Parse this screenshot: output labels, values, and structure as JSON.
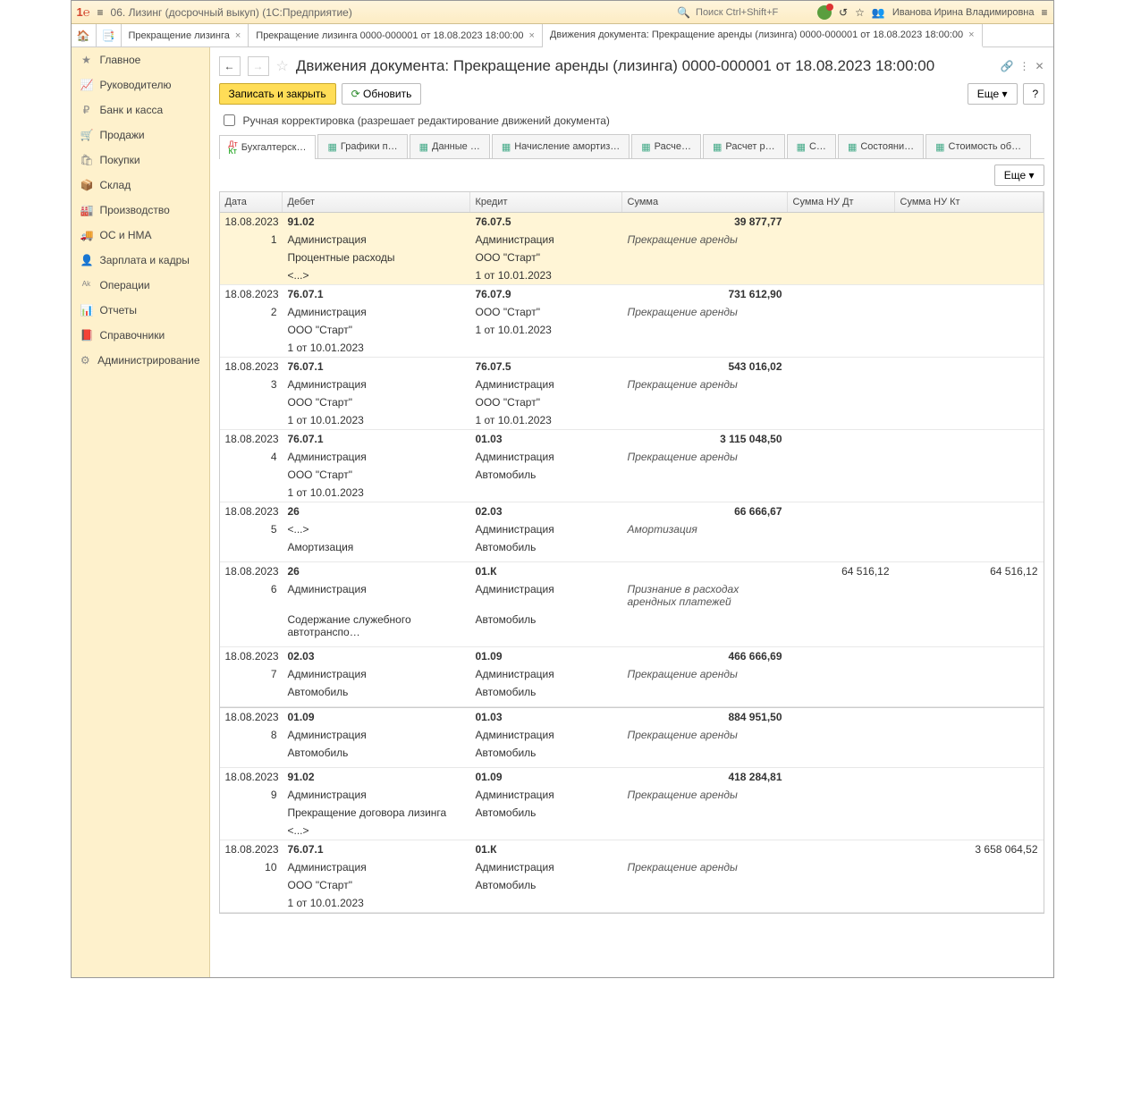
{
  "app": {
    "title": "06. Лизинг (досрочный выкуп)  (1С:Предприятие)",
    "search_placeholder": "Поиск Ctrl+Shift+F",
    "user": "Иванова Ирина Владимировна"
  },
  "doctabs": [
    {
      "label": "Прекращение лизинга"
    },
    {
      "label": "Прекращение лизинга 0000-000001 от 18.08.2023 18:00:00"
    },
    {
      "label": "Движения документа: Прекращение аренды (лизинга) 0000-000001 от 18.08.2023 18:00:00",
      "active": true
    }
  ],
  "sidebar": [
    "Главное",
    "Руководителю",
    "Банк и касса",
    "Продажи",
    "Покупки",
    "Склад",
    "Производство",
    "ОС и НМА",
    "Зарплата и кадры",
    "Операции",
    "Отчеты",
    "Справочники",
    "Администрирование"
  ],
  "sidebar_icons": [
    "★",
    "📈",
    "₽",
    "🛒",
    "🛍",
    "📦",
    "🏭",
    "🚚",
    "👤",
    "ᴬᵏ",
    "📊",
    "📕",
    "⚙"
  ],
  "page": {
    "title": "Движения документа: Прекращение аренды (лизинга) 0000-000001 от 18.08.2023 18:00:00",
    "save_close": "Записать и закрыть",
    "refresh": "Обновить",
    "more": "Еще",
    "manual_correction": "Ручная корректировка (разрешает редактирование движений документа)"
  },
  "inner_tabs": [
    "Бухгалтерск…",
    "Графики п…",
    "Данные …",
    "Начисление амортиз…",
    "Расче…",
    "Расчет р…",
    "С…",
    "Состояни…",
    "Стоимость об…"
  ],
  "grid": {
    "more": "Еще",
    "headers": {
      "date": "Дата",
      "debit": "Дебет",
      "credit": "Кредит",
      "sum": "Сумма",
      "nudt": "Сумма НУ Дт",
      "nukt": "Сумма НУ Кт"
    },
    "entries": [
      {
        "sel": true,
        "date": "18.08.2023",
        "num": "1",
        "debit_acc": "91.02",
        "credit_acc": "76.07.5",
        "sum": "39 877,77",
        "desc": "Прекращение аренды",
        "nudt": "",
        "nukt": "",
        "debit_sub": [
          "Администрация",
          "Процентные расходы",
          "<...>"
        ],
        "credit_sub": [
          "Администрация",
          "ООО \"Старт\"",
          "1 от 10.01.2023"
        ]
      },
      {
        "date": "18.08.2023",
        "num": "2",
        "debit_acc": "76.07.1",
        "credit_acc": "76.07.9",
        "sum": "731 612,90",
        "desc": "Прекращение аренды",
        "nudt": "",
        "nukt": "",
        "debit_sub": [
          "Администрация",
          "ООО \"Старт\"",
          "1 от 10.01.2023"
        ],
        "credit_sub": [
          "ООО \"Старт\"",
          "1 от 10.01.2023",
          ""
        ]
      },
      {
        "date": "18.08.2023",
        "num": "3",
        "debit_acc": "76.07.1",
        "credit_acc": "76.07.5",
        "sum": "543 016,02",
        "desc": "Прекращение аренды",
        "nudt": "",
        "nukt": "",
        "debit_sub": [
          "Администрация",
          "ООО \"Старт\"",
          "1 от 10.01.2023"
        ],
        "credit_sub": [
          "Администрация",
          "ООО \"Старт\"",
          "1 от 10.01.2023"
        ]
      },
      {
        "date": "18.08.2023",
        "num": "4",
        "debit_acc": "76.07.1",
        "credit_acc": "01.03",
        "sum": "3 115 048,50",
        "desc": "Прекращение аренды",
        "nudt": "",
        "nukt": "",
        "debit_sub": [
          "Администрация",
          "ООО \"Старт\"",
          "1 от 10.01.2023"
        ],
        "credit_sub": [
          "Администрация",
          "Автомобиль",
          ""
        ]
      },
      {
        "date": "18.08.2023",
        "num": "5",
        "debit_acc": "26",
        "credit_acc": "02.03",
        "sum": "66 666,67",
        "desc": "Амортизация",
        "nudt": "",
        "nukt": "",
        "debit_sub": [
          "<...>",
          "Амортизация",
          ""
        ],
        "credit_sub": [
          "Администрация",
          "Автомобиль",
          ""
        ]
      },
      {
        "date": "18.08.2023",
        "num": "6",
        "debit_acc": "26",
        "credit_acc": "01.К",
        "sum": "",
        "desc": "Признание в расходах арендных платежей",
        "nudt": "64 516,12",
        "nukt": "64 516,12",
        "debit_sub": [
          "Администрация",
          "Содержание служебного автотранспо…",
          ""
        ],
        "credit_sub": [
          "Администрация",
          "Автомобиль",
          ""
        ]
      },
      {
        "date": "18.08.2023",
        "num": "7",
        "debit_acc": "02.03",
        "credit_acc": "01.09",
        "sum": "466 666,69",
        "desc": "Прекращение аренды",
        "nudt": "",
        "nukt": "",
        "debit_sub": [
          "Администрация",
          "Автомобиль",
          ""
        ],
        "credit_sub": [
          "Администрация",
          "Автомобиль",
          ""
        ]
      }
    ],
    "entries2": [
      {
        "date": "18.08.2023",
        "num": "8",
        "debit_acc": "01.09",
        "credit_acc": "01.03",
        "sum": "884 951,50",
        "desc": "Прекращение аренды",
        "nudt": "",
        "nukt": "",
        "debit_sub": [
          "Администрация",
          "Автомобиль",
          ""
        ],
        "credit_sub": [
          "Администрация",
          "Автомобиль",
          ""
        ]
      },
      {
        "date": "18.08.2023",
        "num": "9",
        "debit_acc": "91.02",
        "credit_acc": "01.09",
        "sum": "418 284,81",
        "desc": "Прекращение аренды",
        "nudt": "",
        "nukt": "",
        "debit_sub": [
          "Администрация",
          "Прекращение договора лизинга",
          "<...>"
        ],
        "credit_sub": [
          "Администрация",
          "Автомобиль",
          ""
        ]
      },
      {
        "date": "18.08.2023",
        "num": "10",
        "debit_acc": "76.07.1",
        "credit_acc": "01.К",
        "sum": "",
        "desc": "Прекращение аренды",
        "nudt": "",
        "nukt": "3 658 064,52",
        "debit_sub": [
          "Администрация",
          "ООО \"Старт\"",
          "1 от 10.01.2023"
        ],
        "credit_sub": [
          "Администрация",
          "Автомобиль",
          ""
        ]
      }
    ]
  }
}
